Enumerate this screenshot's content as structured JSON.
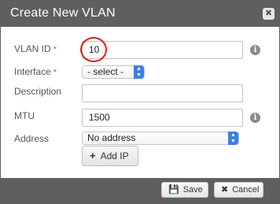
{
  "dialog": {
    "title": "Create New VLAN",
    "close_glyph": "✖"
  },
  "form": {
    "vlan_id": {
      "label": "VLAN ID",
      "required_mark": "*",
      "value": "10"
    },
    "interface": {
      "label": "Interface",
      "required_mark": "*",
      "selected": "- select -"
    },
    "description": {
      "label": "Description",
      "value": ""
    },
    "mtu": {
      "label": "MTU",
      "value": "1500"
    },
    "address": {
      "label": "Address",
      "selected": "No address"
    },
    "add_ip": {
      "label": "Add IP",
      "glyph": "+"
    },
    "info_glyph": "i"
  },
  "footer": {
    "save_label": "Save",
    "cancel_label": "Cancel",
    "save_glyph": "💾",
    "cancel_glyph": "✖"
  },
  "colors": {
    "titlebar": "#5f5f5f",
    "select_accent": "#3d7ee6",
    "annotation": "#e01b1b"
  },
  "icons": [
    "close-icon",
    "info-icon",
    "chevron-updown-icon",
    "plus-icon",
    "save-icon",
    "cancel-icon"
  ]
}
